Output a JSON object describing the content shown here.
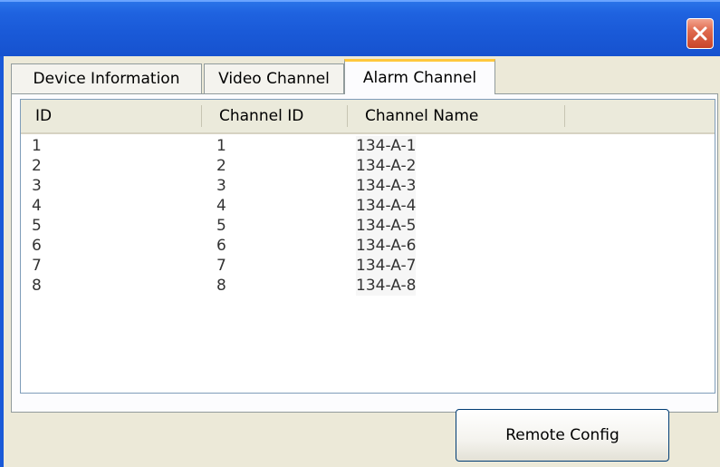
{
  "window": {
    "close_icon": "close-icon"
  },
  "tabs": [
    {
      "label": "Device Information",
      "active": false
    },
    {
      "label": "Video Channel",
      "active": false
    },
    {
      "label": "Alarm Channel",
      "active": true
    }
  ],
  "table": {
    "columns": [
      "ID",
      "Channel ID",
      "Channel Name"
    ],
    "rows": [
      [
        "1",
        "1",
        "134-A-1"
      ],
      [
        "2",
        "2",
        "134-A-2"
      ],
      [
        "3",
        "3",
        "134-A-3"
      ],
      [
        "4",
        "4",
        "134-A-4"
      ],
      [
        "5",
        "5",
        "134-A-5"
      ],
      [
        "6",
        "6",
        "134-A-6"
      ],
      [
        "7",
        "7",
        "134-A-7"
      ],
      [
        "8",
        "8",
        "134-A-8"
      ]
    ]
  },
  "footer": {
    "remote_config_label": "Remote Config"
  },
  "colors": {
    "titlebar": "#1a5ad8",
    "close_button": "#e06b4f",
    "active_tab_accent": "#ffc83c",
    "dialog_bg": "#ece9d8"
  }
}
